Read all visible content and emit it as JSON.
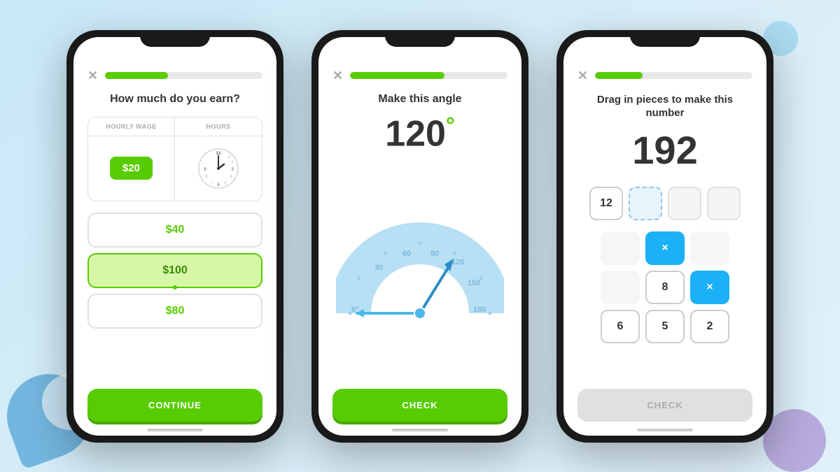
{
  "background": {
    "color": "#c8e8f8"
  },
  "phone1": {
    "progress": 40,
    "title": "How much do you earn?",
    "table": {
      "col1_header": "Hourly WAGE",
      "col2_header": "hours",
      "wage_value": "$20",
      "clock_label": "Clock"
    },
    "options": [
      {
        "label": "$40",
        "selected": false
      },
      {
        "label": "$100",
        "selected": true
      },
      {
        "label": "$80",
        "selected": false
      }
    ],
    "continue_label": "CONTINUE"
  },
  "phone2": {
    "progress": 60,
    "title": "Make this angle",
    "angle_value": "120",
    "angle_symbol": "°",
    "check_label": "CHECK"
  },
  "phone3": {
    "progress": 30,
    "title": "Drag in pieces to make this\nnumber",
    "target_number": "192",
    "slots": [
      {
        "value": "12",
        "type": "filled"
      },
      {
        "value": "",
        "type": "empty"
      },
      {
        "value": "",
        "type": "ghost"
      },
      {
        "value": "",
        "type": "ghost"
      }
    ],
    "tiles": [
      {
        "value": "×",
        "type": "blue",
        "row": 1
      },
      {
        "value": "8",
        "type": "white-border",
        "row": 2
      },
      {
        "value": "×",
        "type": "blue",
        "row": 2
      },
      {
        "value": "",
        "type": "empty-slot",
        "row": 1
      },
      {
        "value": "6",
        "type": "white-border",
        "row": 3
      },
      {
        "value": "5",
        "type": "white-border",
        "row": 3
      },
      {
        "value": "2",
        "type": "white-border",
        "row": 3
      }
    ],
    "check_label": "CHECK"
  }
}
